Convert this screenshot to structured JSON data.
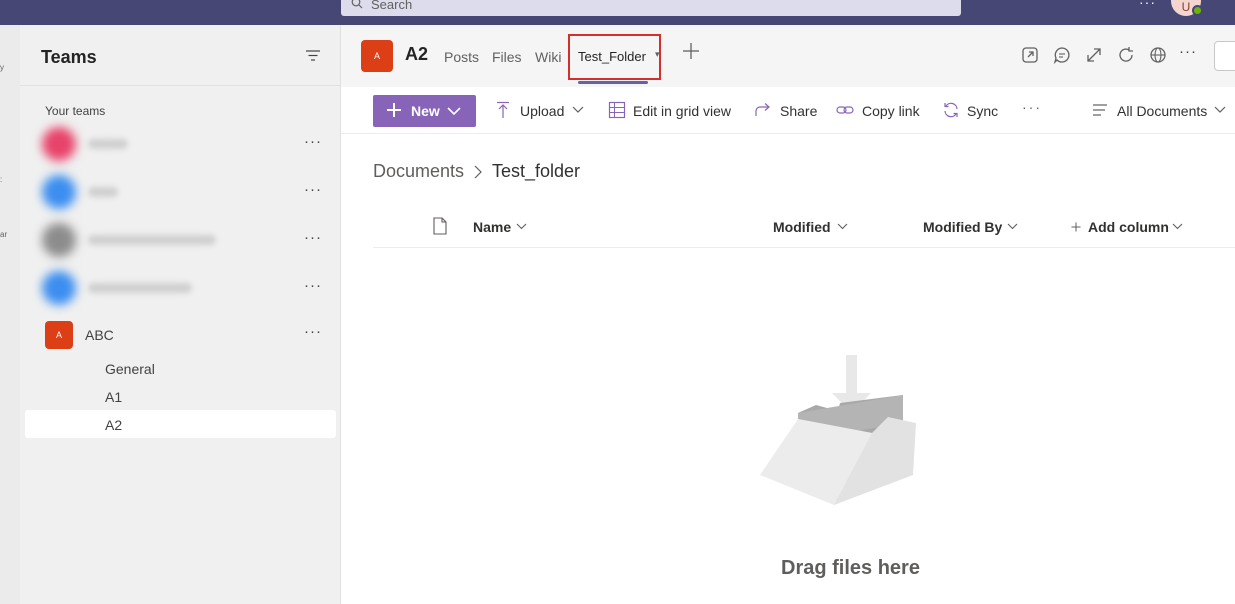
{
  "topbar": {
    "search_placeholder": "Search",
    "more_label": "···",
    "avatar_initial": "U"
  },
  "teams_panel": {
    "title": "Teams",
    "section_label": "Your teams",
    "more_label": "···",
    "team": {
      "initial": "A",
      "name": "ABC",
      "channels": [
        "General",
        "A1",
        "A2"
      ],
      "active_channel": "A2"
    }
  },
  "channel_header": {
    "avatar_initial": "A",
    "name": "A2",
    "tabs": [
      "Posts",
      "Files",
      "Wiki",
      "Test_Folder"
    ],
    "active_tab": "Test_Folder",
    "more_label": "···"
  },
  "command_bar": {
    "new_label": "New",
    "upload_label": "Upload",
    "grid_label": "Edit in grid view",
    "share_label": "Share",
    "copy_link_label": "Copy link",
    "sync_label": "Sync",
    "more_label": "···",
    "view_label": "All Documents"
  },
  "breadcrumb": {
    "root": "Documents",
    "current": "Test_folder"
  },
  "columns": {
    "name": "Name",
    "modified": "Modified",
    "modified_by": "Modified By",
    "add_column": "Add column"
  },
  "empty_state": {
    "message": "Drag files here"
  },
  "colors": {
    "topbar": "#464775",
    "accent": "#6264a7",
    "new_button": "#8764b8",
    "team_avatar": "#dc3e15",
    "highlight_box": "#d32f2f"
  }
}
